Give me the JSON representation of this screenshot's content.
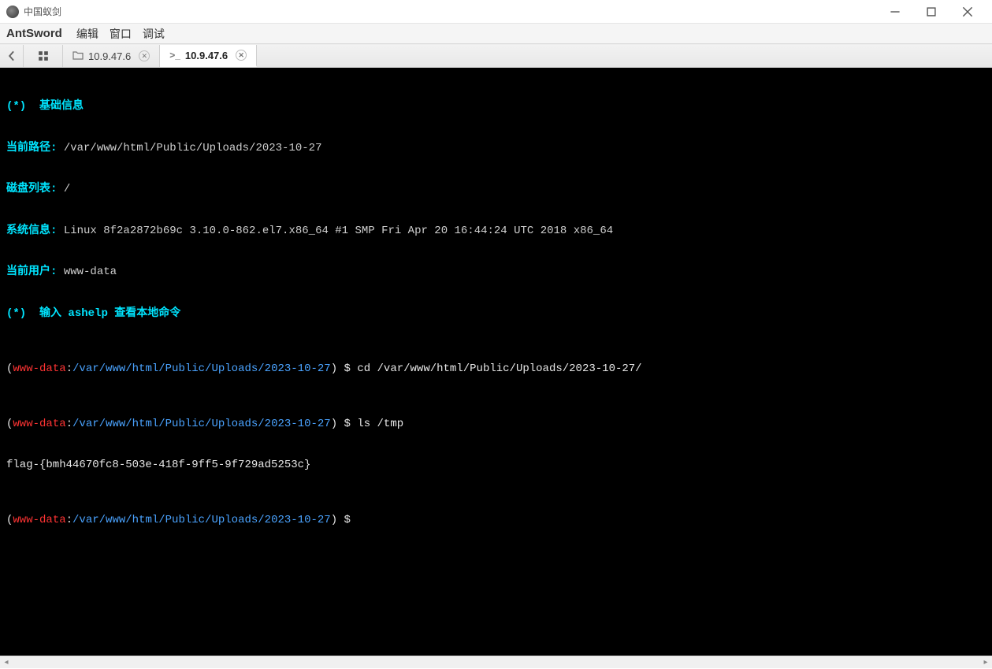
{
  "window": {
    "title": "中国蚁剑"
  },
  "menubar": {
    "brand": "AntSword",
    "items": [
      "编辑",
      "窗口",
      "调试"
    ]
  },
  "tabs": [
    {
      "icon": "folder",
      "label": "10.9.47.6",
      "active": false
    },
    {
      "icon": "terminal",
      "label": "10.9.47.6",
      "active": true
    }
  ],
  "terminal": {
    "header": {
      "title_prefix": "(*)",
      "title": "基础信息",
      "path_label": "当前路径:",
      "path_value": "/var/www/html/Public/Uploads/2023-10-27",
      "disk_label": "磁盘列表:",
      "disk_value": "/",
      "sys_label": "系统信息:",
      "sys_value": "Linux 8f2a2872b69c 3.10.0-862.el7.x86_64 #1 SMP Fri Apr 20 16:44:24 UTC 2018 x86_64",
      "user_label": "当前用户:",
      "user_value": "www-data",
      "help_prefix": "(*)",
      "help_text": "输入 ashelp 查看本地命令"
    },
    "prompt": {
      "user": "www-data",
      "path": "/var/www/html/Public/Uploads/2023-10-27",
      "sep": ":",
      "open": "(",
      "close": ")",
      "dollar": " $ "
    },
    "history": [
      {
        "cmd": "cd /var/www/html/Public/Uploads/2023-10-27/",
        "output": ""
      },
      {
        "cmd": "ls /tmp",
        "output": "flag-{bmh44670fc8-503e-418f-9ff5-9f729ad5253c}"
      },
      {
        "cmd": "",
        "output": ""
      }
    ]
  }
}
